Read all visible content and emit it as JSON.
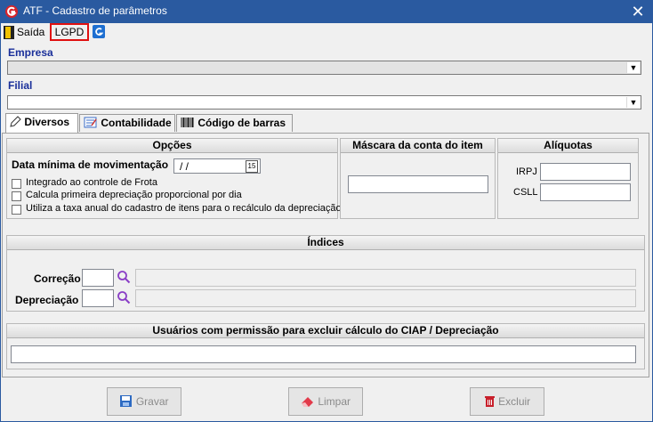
{
  "window": {
    "title": "ATF - Cadastro de parâmetros",
    "close_glyph": "✕"
  },
  "toolbar": {
    "exit_label": "Saída",
    "lgpd_label": "LGPD"
  },
  "empresa": {
    "label": "Empresa",
    "value": ""
  },
  "filial": {
    "label": "Filial",
    "value": ""
  },
  "tabs": [
    {
      "label": "Diversos",
      "icon": "edit-icon",
      "active": true
    },
    {
      "label": "Contabilidade",
      "icon": "ledger-icon",
      "active": false
    },
    {
      "label": "Código de barras",
      "icon": "barcode-icon",
      "active": false
    }
  ],
  "opcoes": {
    "title": "Opções",
    "data_minima_label": "Data mínima de movimentação",
    "data_minima_value": " /  /",
    "calendar_label": "15",
    "checks": [
      {
        "label": "Integrado ao controle de Frota",
        "checked": false
      },
      {
        "label": "Calcula primeira depreciação proporcional por dia",
        "checked": false
      },
      {
        "label": "Utiliza a taxa anual do cadastro de itens para o recálculo da depreciação",
        "checked": false
      }
    ]
  },
  "mascara": {
    "title": "Máscara da conta do item",
    "value": ""
  },
  "aliquotas": {
    "title": "Alíquotas",
    "irpj_label": "IRPJ",
    "irpj_value": "",
    "csll_label": "CSLL",
    "csll_value": ""
  },
  "indices": {
    "title": "Índices",
    "correcao_label": "Correção",
    "depreciacao_label": "Depreciação"
  },
  "usuarios": {
    "title": "Usuários com permissão para excluir cálculo do CIAP / Depreciação",
    "value": ""
  },
  "buttons": {
    "gravar": "Gravar",
    "limpar": "Limpar",
    "excluir": "Excluir"
  },
  "colors": {
    "titlebar": "#2a5aa0",
    "label_blue": "#1a2f9a",
    "lgpd_border": "#e01010"
  }
}
